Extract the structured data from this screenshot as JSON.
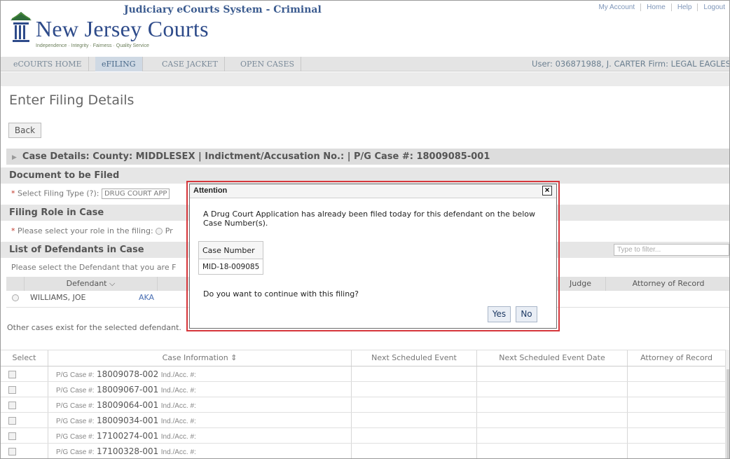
{
  "header": {
    "system_title": "Judiciary eCourts System - Criminal",
    "logo_name": "New Jersey Courts",
    "tagline": "Independence · Integrity · Fairness · Quality Service",
    "top_links": [
      "My Account",
      "Home",
      "Help",
      "Logout"
    ]
  },
  "nav": {
    "tabs": [
      "eCOURTS HOME",
      "eFILING",
      "CASE JACKET",
      "OPEN CASES"
    ],
    "active_tab": "eFILING",
    "user_info": "User: 036871988, J. CARTER  Firm: LEGAL EAGLES"
  },
  "page": {
    "title": "Enter Filing Details",
    "back_label": "Back",
    "case_details": "Case Details: County: MIDDLESEX | Indictment/Accusation No.:  | P/G Case #: 18009085-001"
  },
  "document_section": {
    "header": "Document to be Filed",
    "select_label": "Select Filing Type (?):",
    "select_value": "DRUG COURT APP"
  },
  "role_section": {
    "header": "Filing Role in Case",
    "label": "Please select your role in the filing:",
    "option_fragment": "Pr"
  },
  "defendants_section": {
    "header": "List of Defendants in Case",
    "filter_placeholder": "Type to filter...",
    "instruction": "Please select the Defendant that you are F",
    "columns": {
      "defendant": "Defendant",
      "judge": "Judge",
      "attorney": "Attorney of Record"
    },
    "rows": [
      {
        "name": "WILLIAMS, JOE",
        "aka": "AKA"
      }
    ]
  },
  "other_cases_text": "Other cases exist for the selected defendant.",
  "cases_table": {
    "columns": [
      "Select",
      "Case Information",
      "Next Scheduled Event",
      "Next Scheduled Event Date",
      "Attorney of Record"
    ],
    "pg_label": "P/G Case #:",
    "ind_label": "Ind./Acc. #:",
    "rows": [
      {
        "pg": "18009078-002"
      },
      {
        "pg": "18009067-001"
      },
      {
        "pg": "18009064-001"
      },
      {
        "pg": "18009034-001"
      },
      {
        "pg": "17100274-001"
      },
      {
        "pg": "17100328-001"
      }
    ]
  },
  "modal": {
    "title": "Attention",
    "close_label": "×",
    "message": "A Drug Court Application has already been filed today for this defendant on the below Case Number(s).",
    "table_header": "Case Number",
    "case_number": "MID-18-009085",
    "question": "Do you want to continue with this filing?",
    "yes_label": "Yes",
    "no_label": "No"
  },
  "colors": {
    "highlight_border": "#d6363b",
    "brand_blue": "#2e4b8a"
  }
}
